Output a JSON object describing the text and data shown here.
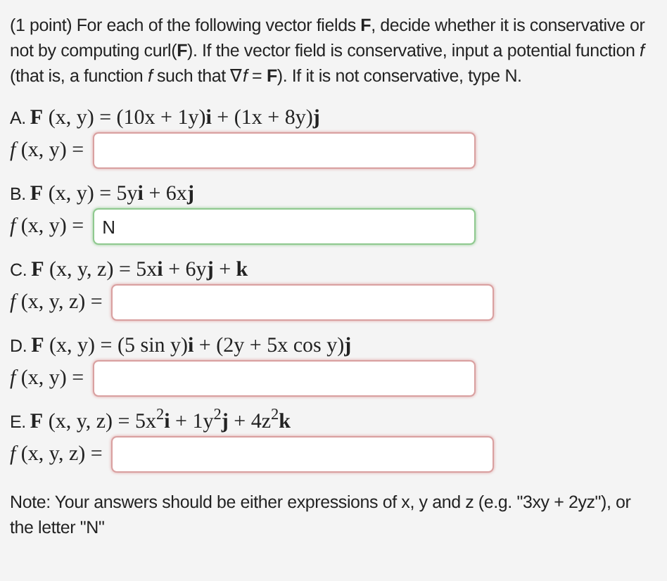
{
  "intro": "(1 point) For each of the following vector fields **F**, decide whether it is conservative or not by computing curl(**F**). If the vector field is conservative, input a potential function *f* (that is, a function *f* such that ∇*f* = **F**). If it is not conservative, type N.",
  "parts": [
    {
      "label": "A.",
      "formula": "**F** (x, y) = (10x + 1y)**i** + (1x + 8y)**j**",
      "prompt": "*f* (x, y) =",
      "correct": false
    },
    {
      "label": "B.",
      "formula": "**F** (x, y) = 5y**i** + 6x**j**",
      "prompt": "*f* (x, y) =",
      "value": "N",
      "correct": true
    },
    {
      "label": "C.",
      "formula": "**F** (x, y, z) = 5x**i** + 6y**j** + **k**",
      "prompt": "*f* (x, y, z) =",
      "correct": false
    },
    {
      "label": "D.",
      "formula": "**F** (x, y) = (5 sin y)**i** + (2y + 5x cos y)**j**",
      "prompt": "*f* (x, y) =",
      "correct": false
    },
    {
      "label": "E.",
      "formula": "**F** (x, y, z) = 5x$^{2}$**i** + 1y$^{2}$**j** + 4z$^{2}$**k**",
      "prompt": "*f* (x, y, z) =",
      "correct": false
    }
  ],
  "note": "Note: Your answers should be either expressions of x, y and z (e.g. \"3xy + 2yz\"), or the letter \"N\""
}
